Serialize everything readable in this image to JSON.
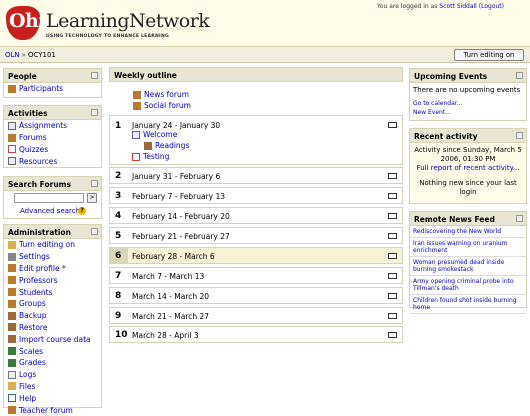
{
  "header": {
    "logo_part1": "Ohio",
    "logo_part2": "LearningNetwork",
    "logo_tagline": "USING TECHNOLOGY TO ENHANCE LEARNING",
    "login_prefix": "You are logged in as",
    "login_user": "Scott Siddall",
    "login_logout": "(Logout)"
  },
  "navbar": {
    "crumb_home": "OLN",
    "crumb_sep": "»",
    "crumb_course": "OCY101",
    "edit_button": "Turn editing on"
  },
  "people": {
    "title": "People",
    "items": [
      "Participants"
    ]
  },
  "activities": {
    "title": "Activities",
    "items": [
      "Assignments",
      "Forums",
      "Quizzes",
      "Resources"
    ]
  },
  "search_forums": {
    "title": "Search Forums",
    "go_label": ">",
    "advanced": "Advanced search",
    "help_icon": "?"
  },
  "administration": {
    "title": "Administration",
    "items": [
      "Turn editing on",
      "Settings",
      "Edit profile *",
      "Professors",
      "Students",
      "Groups",
      "Backup",
      "Restore",
      "Import course data",
      "Scales",
      "Grades",
      "Logs",
      "Files",
      "Help",
      "Teacher forum"
    ]
  },
  "outline": {
    "title": "Weekly outline",
    "top_items": [
      "News forum",
      "Social forum"
    ],
    "weeks": [
      {
        "num": "1",
        "label": "January 24 - January 30",
        "items": [
          "Welcome",
          "Readings",
          "Testing"
        ]
      },
      {
        "num": "2",
        "label": "January 31 - February 6"
      },
      {
        "num": "3",
        "label": "February 7 - February 13"
      },
      {
        "num": "4",
        "label": "February 14 - February 20"
      },
      {
        "num": "5",
        "label": "February 21 - February 27"
      },
      {
        "num": "6",
        "label": "February 28 - March 6"
      },
      {
        "num": "7",
        "label": "March 7 - March 13"
      },
      {
        "num": "8",
        "label": "March 14 - March 20"
      },
      {
        "num": "9",
        "label": "March 21 - March 27"
      },
      {
        "num": "10",
        "label": "March 28 - April 3"
      }
    ]
  },
  "upcoming": {
    "title": "Upcoming Events",
    "text": "There are no upcoming events",
    "link1": "Go to calendar...",
    "link2": "New Event..."
  },
  "recent": {
    "title": "Recent activity",
    "since": "Activity since Sunday, March 5 2006, 01:30 PM",
    "full_report": "Full report of recent activity...",
    "nothing": "Nothing new since your last login"
  },
  "remote_news": {
    "title": "Remote News Feed",
    "items": [
      "Rediscovering the New World",
      "Iran issues warning on uranium enrichment",
      "Woman presumed dead inside burning smokestack",
      "Army opening criminal probe into Tillman's death",
      "Children found shot inside burning home"
    ]
  },
  "colors": {
    "accent_red": "#c8201c",
    "link": "#0000cc",
    "block_header": "#e8e6d2"
  }
}
